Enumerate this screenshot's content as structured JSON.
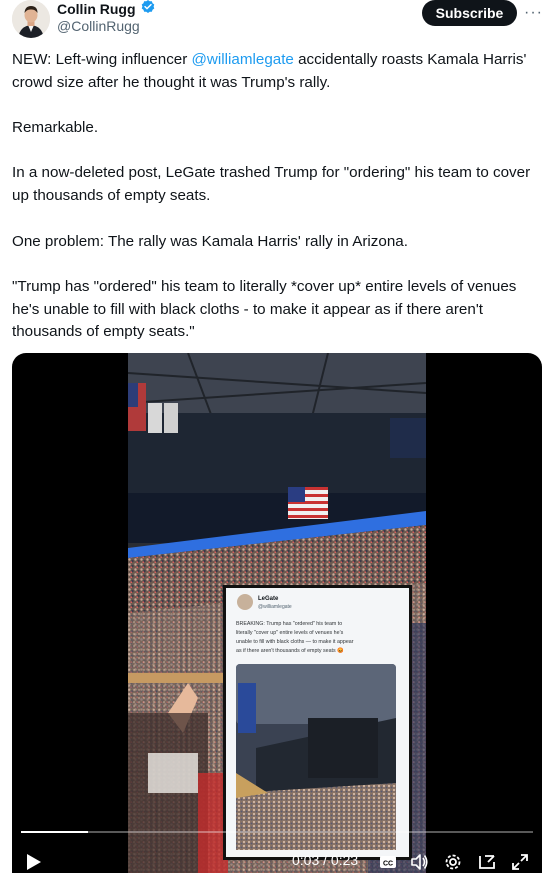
{
  "author": {
    "name": "Collin Rugg",
    "handle": "@CollinRugg",
    "verified": true
  },
  "actions": {
    "subscribe_label": "Subscribe",
    "more_label": "···"
  },
  "tweet": {
    "p1_pre": "NEW: Left-wing influencer ",
    "p1_mention": "@williamlegate",
    "p1_post": " accidentally roasts Kamala Harris' crowd size after he thought it was Trump's rally.",
    "p2": "Remarkable.",
    "p3": "In a now-deleted post, LeGate trashed Trump for \"ordering\" his team to cover up thousands of empty seats.",
    "p4": "One problem: The rally was Kamala Harris' rally in Arizona.",
    "p5": "\"Trump has \"ordered\" his team to literally *cover up* entire levels of venues he's unable to fill with black cloths - to make it appear as if there aren't thousands of empty seats.\""
  },
  "video": {
    "time_label": "0:03 / 0:23",
    "progress_fraction": 0.13,
    "embedded_post": {
      "name": "LeGate",
      "handle": "@williamlegate",
      "text": "BREAKING: Trump has \"ordered\" his team to literally \"cover up\" entire levels of venues he's unable to fill with black cloths — to make it appear as if there aren't thousands of empty seats 😡"
    }
  },
  "colors": {
    "link": "#1d9bf0",
    "text": "#0f1419",
    "secondary": "#536471",
    "verified_badge": "#1d9bf0"
  }
}
